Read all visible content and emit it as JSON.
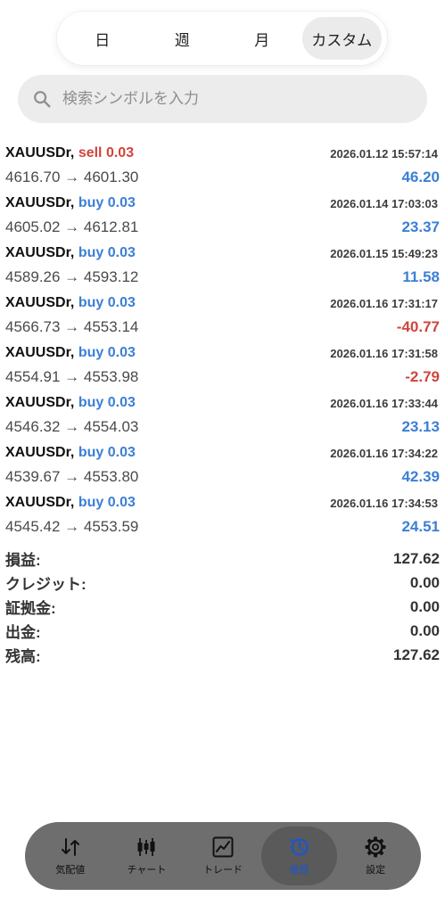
{
  "period": {
    "tabs": [
      "日",
      "週",
      "月",
      "カスタム"
    ],
    "selected": "カスタム"
  },
  "search": {
    "placeholder": "検索シンボルを入力",
    "value": ""
  },
  "trades": [
    {
      "symbol": "XAUUSDr,",
      "side": "sell",
      "volume": "0.03",
      "time": "2026.01.12 15:57:14",
      "prices": "4616.70 → 4601.30",
      "profit": "46.20"
    },
    {
      "symbol": "XAUUSDr,",
      "side": "buy",
      "volume": "0.03",
      "time": "2026.01.14 17:03:03",
      "prices": "4605.02 → 4612.81",
      "profit": "23.37"
    },
    {
      "symbol": "XAUUSDr,",
      "side": "buy",
      "volume": "0.03",
      "time": "2026.01.15 15:49:23",
      "prices": "4589.26 → 4593.12",
      "profit": "11.58"
    },
    {
      "symbol": "XAUUSDr,",
      "side": "buy",
      "volume": "0.03",
      "time": "2026.01.16 17:31:17",
      "prices": "4566.73 → 4553.14",
      "profit": "-40.77"
    },
    {
      "symbol": "XAUUSDr,",
      "side": "buy",
      "volume": "0.03",
      "time": "2026.01.16 17:31:58",
      "prices": "4554.91 → 4553.98",
      "profit": "-2.79"
    },
    {
      "symbol": "XAUUSDr,",
      "side": "buy",
      "volume": "0.03",
      "time": "2026.01.16 17:33:44",
      "prices": "4546.32 → 4554.03",
      "profit": "23.13"
    },
    {
      "symbol": "XAUUSDr,",
      "side": "buy",
      "volume": "0.03",
      "time": "2026.01.16 17:34:22",
      "prices": "4539.67 → 4553.80",
      "profit": "42.39"
    },
    {
      "symbol": "XAUUSDr,",
      "side": "buy",
      "volume": "0.03",
      "time": "2026.01.16 17:34:53",
      "prices": "4545.42 → 4553.59",
      "profit": "24.51"
    }
  ],
  "summary": [
    {
      "label": "損益:",
      "value": "127.62"
    },
    {
      "label": "クレジット:",
      "value": "0.00"
    },
    {
      "label": "証拠金:",
      "value": "0.00"
    },
    {
      "label": "出金:",
      "value": "0.00"
    },
    {
      "label": "残高:",
      "value": "127.62"
    }
  ],
  "nav": [
    {
      "label": "気配値",
      "icon": "quotes-arrows-icon"
    },
    {
      "label": "チャート",
      "icon": "candlestick-chart-icon"
    },
    {
      "label": "トレード",
      "icon": "trade-chart-icon"
    },
    {
      "label": "履歴",
      "icon": "history-clock-icon"
    },
    {
      "label": "設定",
      "icon": "gear-icon"
    }
  ],
  "nav_selected": "履歴",
  "colors": {
    "sell": "#d1453b",
    "buy": "#3b7fd6",
    "profit_positive": "#3b7fd6",
    "profit_negative": "#d1453b",
    "nav_active": "#1f55c9"
  }
}
